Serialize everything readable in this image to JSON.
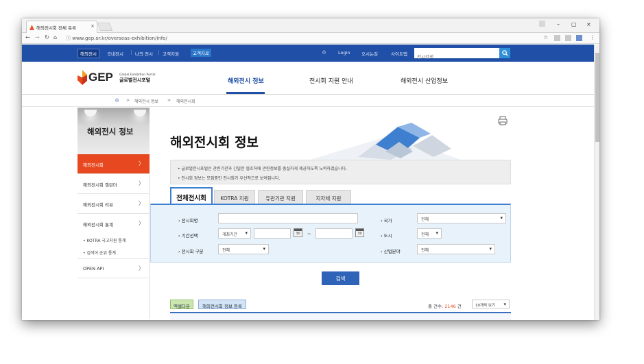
{
  "browser": {
    "tab_title": "해외전시회 전체 목록",
    "tab_close": "×",
    "url": "www.gep.or.kr/overseas-exhibition/info/",
    "window_controls": [
      "–",
      "▢",
      "×"
    ]
  },
  "topbar": {
    "items": [
      "해외전시",
      "국내전시",
      "나의 전시",
      "고객지원",
      "고객지로"
    ],
    "home_icon": "home-icon",
    "links": [
      "Login",
      "오시는길",
      "사이트맵"
    ],
    "search_placeholder": "전시검색",
    "search_icon": "🔍"
  },
  "header": {
    "logo_text": "GEP",
    "logo_sub_en": "Global Exhibition Portal",
    "logo_sub_ko": "글로벌전시포털",
    "nav": [
      "해외전시 정보",
      "전시회 지원 안내",
      "해외전시 산업정보"
    ]
  },
  "breadcrumb": {
    "items": [
      "해외전시 정보",
      "해외전시회"
    ],
    "sep": ">"
  },
  "sidebar": {
    "title": "해외전시 정보",
    "items": [
      {
        "label": "해외전시회",
        "arrow": "〉"
      },
      {
        "label": "해외전시회 캘린더",
        "arrow": "〉"
      },
      {
        "label": "해외전시회 리뷰",
        "arrow": "〉"
      },
      {
        "label": "해외전시회 통계",
        "arrow": "〉"
      }
    ],
    "subitems": [
      "KOTRA 국고지원 통계",
      "검색어 순위 통계"
    ],
    "open_api": {
      "label": "OPEN API",
      "arrow": "〉"
    }
  },
  "main": {
    "title": "해외전시회 정보",
    "notices": [
      "• 글로벌전시포털은 관련기관과 긴밀한 협조하에 관련정보를 충실하게 제공하도록 노력하겠습니다.",
      "• 전시회 정보는 모집중인 전시회가 우선적으로 보여집니다."
    ],
    "tabs": [
      "전체전시회",
      "KOTRA 지원",
      "유관기관 지원",
      "지자체 지원"
    ],
    "form": {
      "name_label": "› 전시회명",
      "name_value": "",
      "country_label": "› 국가",
      "country_value": "전체",
      "period_label": "› 기간선택",
      "period_type": "개최기간",
      "date_from": "",
      "date_sep": "~",
      "date_to": "",
      "cal_text": "30",
      "city_label": "› 도시",
      "city_value": "전체",
      "category_label": "› 전시회 구분",
      "category_value": "전체",
      "industry_label": "› 산업분야",
      "industry_value": "전체"
    },
    "search_button": "검색",
    "excel_button": "엑셀다운",
    "register_button": "해외전시회 정보 등록",
    "count_label": "총 건수: ",
    "count_value": "2146",
    "count_unit": " 건",
    "per_page": "10개씩 보기"
  }
}
